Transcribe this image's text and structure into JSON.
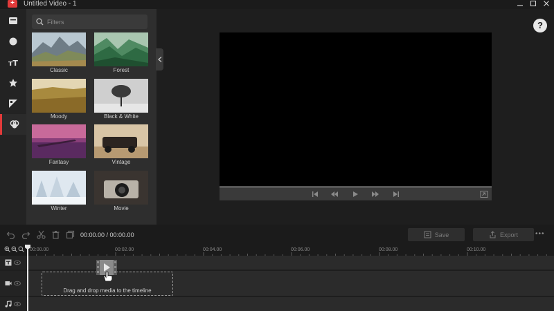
{
  "window": {
    "title": "Untitled Video - 1",
    "logo_glyph": "+"
  },
  "rail": {
    "items": [
      {
        "icon": "media-icon",
        "active": false
      },
      {
        "icon": "audio-icon",
        "active": false
      },
      {
        "icon": "text-icon",
        "active": false,
        "glyph": "тT"
      },
      {
        "icon": "effects-icon",
        "active": false
      },
      {
        "icon": "transitions-icon",
        "active": false
      },
      {
        "icon": "filters-icon",
        "active": true
      }
    ]
  },
  "filters": {
    "search_placeholder": "Filters",
    "items": [
      {
        "label": "Classic"
      },
      {
        "label": "Forest"
      },
      {
        "label": "Moody"
      },
      {
        "label": "Black & White"
      },
      {
        "label": "Fantasy"
      },
      {
        "label": "Vintage"
      },
      {
        "label": "Winter"
      },
      {
        "label": "Movie"
      }
    ]
  },
  "preview": {
    "help_glyph": "?"
  },
  "toolbar": {
    "timecode": "00:00.00 / 00:00.00",
    "save_label": "Save",
    "export_label": "Export",
    "more_glyph": "•••"
  },
  "timeline": {
    "ticks": [
      "00:00.00",
      "00:02.00",
      "00:04.00",
      "00:06.00",
      "00:08.00",
      "00:10.00"
    ],
    "drop_text": "Drag and drop media to the timeline"
  },
  "colors": {
    "accent": "#e23a3a",
    "background": "#1e1e1e",
    "panel": "#2e2e2e"
  }
}
